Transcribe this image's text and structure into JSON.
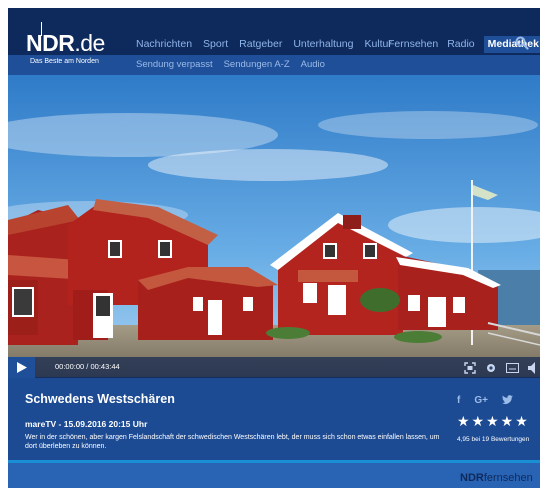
{
  "header": {
    "logo_text": "NDR",
    "logo_tld": ".de",
    "tagline": "Das Beste am Norden"
  },
  "nav": {
    "items": [
      "Nachrichten",
      "Sport",
      "Ratgeber",
      "Unterhaltung",
      "Kultur"
    ],
    "right_items": [
      "Fernsehen",
      "Radio",
      "Mediathek"
    ],
    "active": "Mediathek"
  },
  "subnav": {
    "items": [
      "Sendung verpasst",
      "Sendungen A-Z",
      "Audio"
    ]
  },
  "player": {
    "current_time": "00:00:00",
    "duration": "00:43:44",
    "time_separator": "/",
    "progress": 0
  },
  "info": {
    "title": "Schwedens Westschären",
    "subtitle": "mareTV - 15.09.2016 20:15 Uhr",
    "description": "Wer in der schönen, aber kargen Felslandschaft der schwedischen Westschären lebt, der muss sich schon etwas einfallen lassen, um dort überleben zu können.",
    "social": [
      "f",
      "G+"
    ],
    "stars": "★★★★★",
    "rating_text": "4,95 bei 19 Bewertungen"
  },
  "footer": {
    "logo_bold": "NDR",
    "logo_rest": "fernsehen"
  },
  "colors": {
    "header_bg": "#0e2a5c",
    "accent": "#1f4f98",
    "info_bg": "#1c4a93",
    "nav_text": "#8fb4ea"
  }
}
